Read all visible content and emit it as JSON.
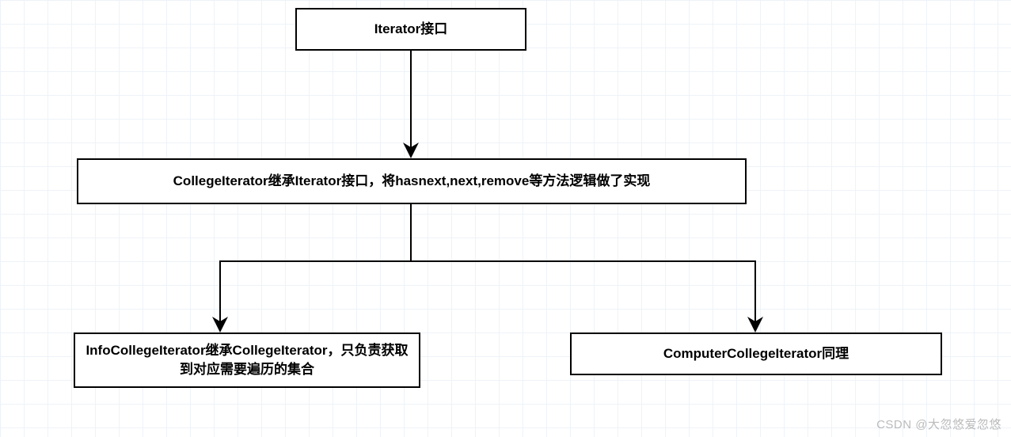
{
  "diagram": {
    "nodes": {
      "root": {
        "label": "Iterator接口"
      },
      "college": {
        "label": "CollegeIterator继承Iterator接口，将hasnext,next,remove等方法逻辑做了实现"
      },
      "info": {
        "label": "InfoCollegeIterator继承CollegeIterator，只负责获取到对应需要遍历的集合"
      },
      "computer": {
        "label": "ComputerCollegeIterator同理"
      }
    },
    "edges": [
      {
        "from": "root",
        "to": "college"
      },
      {
        "from": "college",
        "to": "info"
      },
      {
        "from": "college",
        "to": "computer"
      }
    ]
  },
  "watermark": "CSDN @大忽悠爱忽悠"
}
